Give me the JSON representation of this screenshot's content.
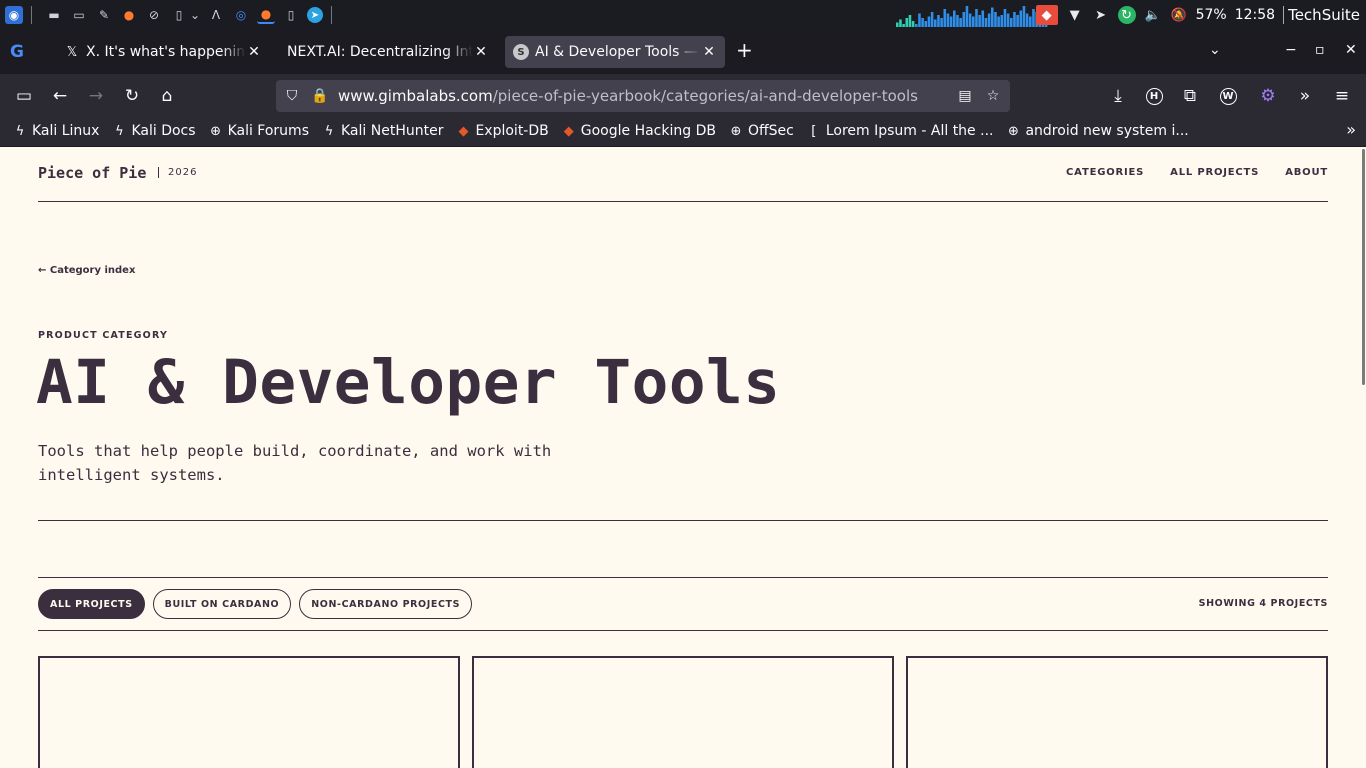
{
  "taskbar": {
    "battery": "57%",
    "clock": "12:58",
    "user": "TechSuite",
    "activity_bars": [
      3,
      5,
      2,
      6,
      8,
      4,
      2,
      9,
      6,
      4,
      7,
      10,
      5,
      8,
      6,
      12,
      9,
      7,
      11,
      8,
      6,
      10,
      14,
      9,
      7,
      12,
      8,
      11,
      6,
      9,
      13,
      10,
      7,
      8,
      12,
      9,
      6,
      10,
      8,
      11,
      14,
      9,
      7,
      12,
      10,
      8,
      6,
      11
    ]
  },
  "browser": {
    "tabs": [
      {
        "title": "X. It's what's happening / X",
        "favicon": "x-icon",
        "close": "✕"
      },
      {
        "title": "NEXT.AI: Decentralizing Intelligence",
        "favicon": "",
        "close": "✕"
      },
      {
        "title": "AI & Developer Tools — Piece of Pie",
        "favicon": "S",
        "close": "✕"
      }
    ],
    "new_tab": "+",
    "url_host": "www.gimbalabs.com",
    "url_path": "/piece-of-pie-yearbook/categories/ai-and-developer-tools",
    "bookmarks": [
      {
        "label": "Kali Linux",
        "icon": "kali-dragon-icon"
      },
      {
        "label": "Kali Docs",
        "icon": "kali-dragon-icon"
      },
      {
        "label": "Kali Forums",
        "icon": "globe-icon"
      },
      {
        "label": "Kali NetHunter",
        "icon": "kali-dragon-icon"
      },
      {
        "label": "Exploit-DB",
        "icon": "exploit-db-icon"
      },
      {
        "label": "Google Hacking DB",
        "icon": "exploit-db-icon"
      },
      {
        "label": "OffSec",
        "icon": "globe-icon"
      },
      {
        "label": "Lorem Ipsum - All the ...",
        "icon": "lorem-icon"
      },
      {
        "label": "android new system i...",
        "icon": "globe-icon"
      }
    ]
  },
  "site": {
    "logo": "Piece of Pie",
    "year": "2026",
    "nav": [
      "CATEGORIES",
      "ALL PROJECTS",
      "ABOUT"
    ],
    "back_link": "← Category index",
    "eyebrow": "PRODUCT CATEGORY",
    "title": "AI & Developer Tools",
    "description": "Tools that help people build, coordinate, and work with intelligent systems.",
    "filters": [
      "ALL PROJECTS",
      "BUILT ON CARDANO",
      "NON-CARDANO PROJECTS"
    ],
    "active_filter": "ALL PROJECTS",
    "count_label": "SHOWING 4 PROJECTS"
  },
  "colors": {
    "page_bg": "#fffaf0",
    "ink": "#3b2f3f",
    "browser_bg": "#1c1b22",
    "toolbar_bg": "#2b2a33",
    "active_tab": "#42414d"
  }
}
